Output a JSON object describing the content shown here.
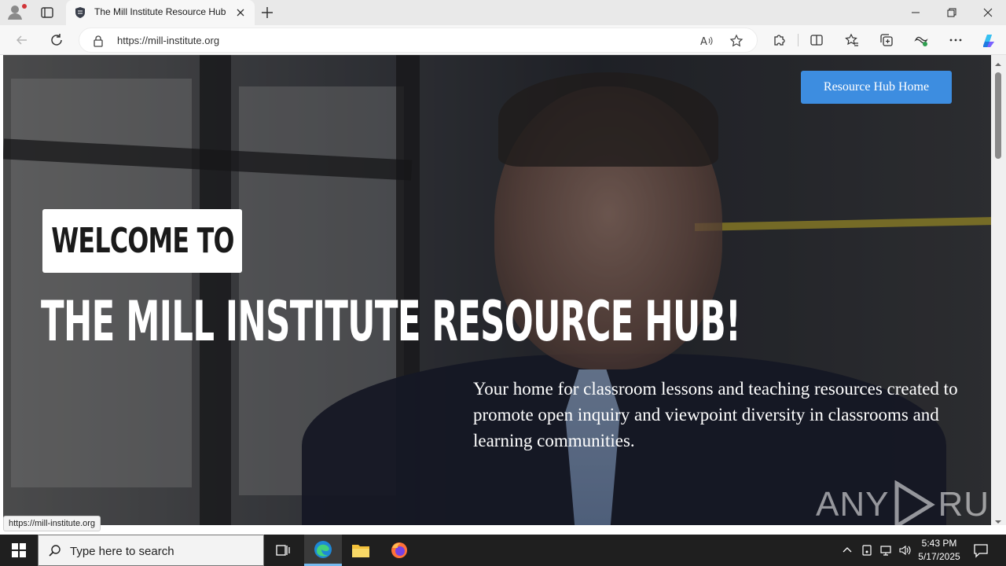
{
  "browser": {
    "tab_title": "The Mill Institute Resource Hub",
    "url": "https://mill-institute.org",
    "status_link": "https://mill-institute.org"
  },
  "page": {
    "nav_button": "Resource Hub Home",
    "welcome": "WELCOME TO",
    "title": "THE MILL INSTITUTE RESOURCE HUB!",
    "tagline": "Your home for classroom lessons and teaching resources created to promote open inquiry and viewpoint diversity in classrooms and learning communities.",
    "watermark_left": "ANY",
    "watermark_right": "RUN"
  },
  "taskbar": {
    "search_placeholder": "Type here to search",
    "time": "5:43 PM",
    "date": "5/17/2025"
  },
  "colors": {
    "accent_button": "#3d8de0",
    "tab_strip": "#e9e9e9",
    "taskbar": "#1f1f1f"
  }
}
